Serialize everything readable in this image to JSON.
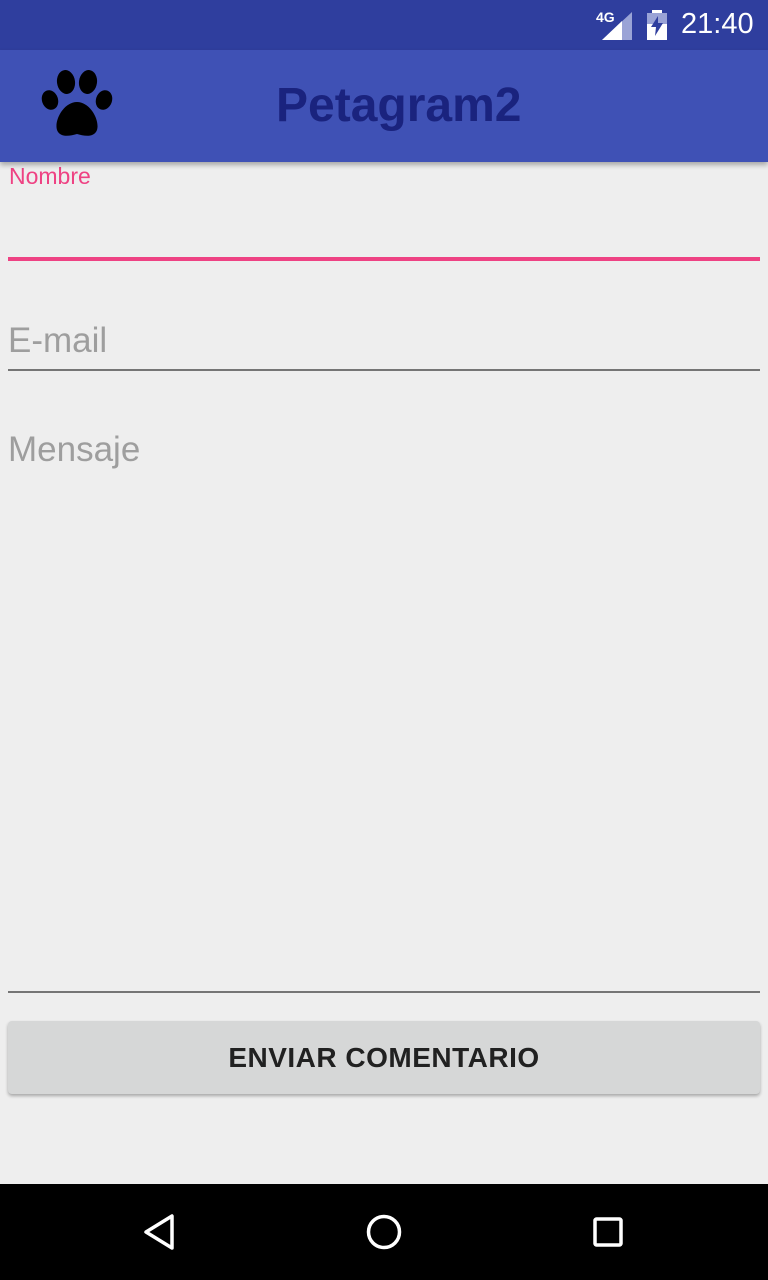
{
  "status_bar": {
    "network": "4G",
    "time": "21:40",
    "signal_icon": "cell-signal-icon",
    "battery_icon": "battery-charging-icon"
  },
  "app_bar": {
    "title": "Petagram2",
    "logo_icon": "paw-icon",
    "title_color": "#1a237e",
    "background": "#3f51b5"
  },
  "form": {
    "nombre": {
      "label": "Nombre",
      "value": ""
    },
    "email": {
      "placeholder": "E-mail",
      "value": ""
    },
    "mensaje": {
      "placeholder": "Mensaje",
      "value": ""
    },
    "submit_label": "ENVIAR COMENTARIO",
    "accent_color": "#ee4283"
  },
  "nav_bar": {
    "back_icon": "back-triangle-icon",
    "home_icon": "home-circle-icon",
    "recents_icon": "recents-square-icon"
  }
}
